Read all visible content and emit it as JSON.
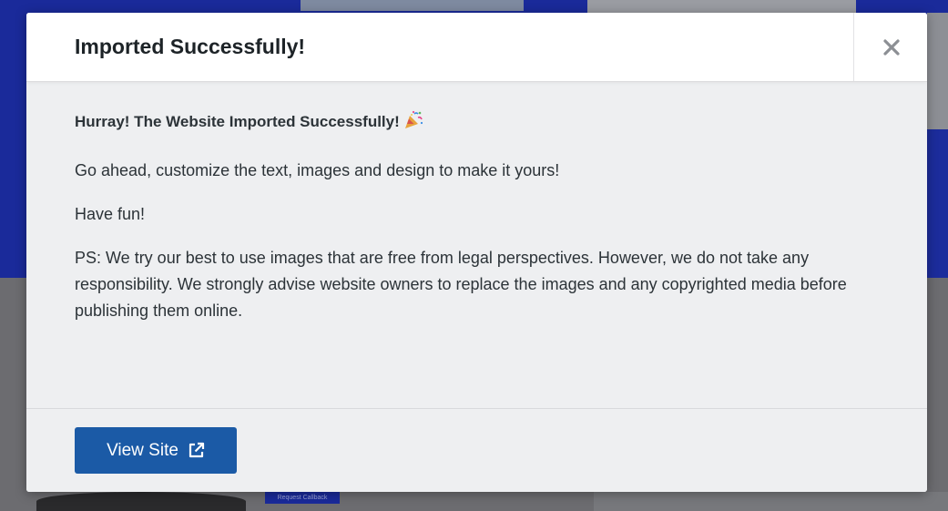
{
  "modal": {
    "title": "Imported Successfully!",
    "close_label": "×",
    "body": {
      "heading": "Hurray! The Website Imported Successfully!",
      "heading_icon": "party-popper-icon",
      "paragraphs": [
        "Go ahead, customize the text, images and design to make it yours!",
        "Have fun!",
        "PS: We try our best to use images that are free from legal perspectives. However, we do not take any responsibility. We strongly advise website owners to replace the images and any copyrighted media before publishing them online."
      ]
    },
    "footer": {
      "view_site_label": "View Site",
      "view_site_icon": "external-link-icon"
    }
  },
  "background_page": {
    "button_label": "Request Callback"
  },
  "colors": {
    "primary_button": "#1b5aa6",
    "modal_background": "#eeeff1",
    "overlay_blue": "#1a2a9a"
  }
}
